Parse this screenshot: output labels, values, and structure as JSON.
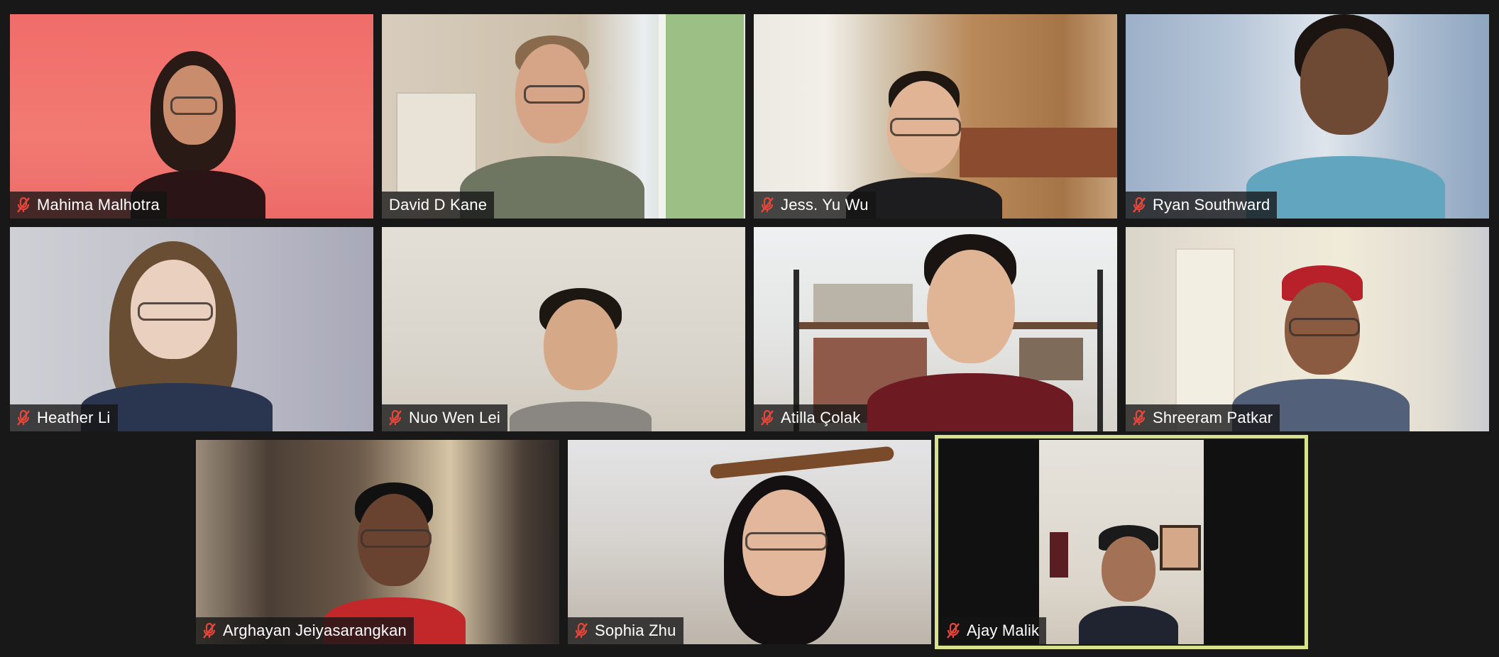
{
  "app": {
    "accent_color": "#d7e28a",
    "muted_icon_color": "#e5473c"
  },
  "participants": [
    {
      "name": "Mahima Malhotra",
      "muted": true
    },
    {
      "name": "David D Kane",
      "muted": false
    },
    {
      "name": "Jess. Yu Wu",
      "muted": true
    },
    {
      "name": "Ryan Southward",
      "muted": true
    },
    {
      "name": "Heather Li",
      "muted": true
    },
    {
      "name": "Nuo Wen Lei",
      "muted": true
    },
    {
      "name": "Atilla Çolak",
      "muted": true
    },
    {
      "name": "Shreeram Patkar",
      "muted": true
    },
    {
      "name": "Arghayan Jeiyasarangkan",
      "muted": true
    },
    {
      "name": "Sophia Zhu",
      "muted": true
    },
    {
      "name": "Ajay Malik",
      "muted": true,
      "active_speaker": true
    }
  ]
}
